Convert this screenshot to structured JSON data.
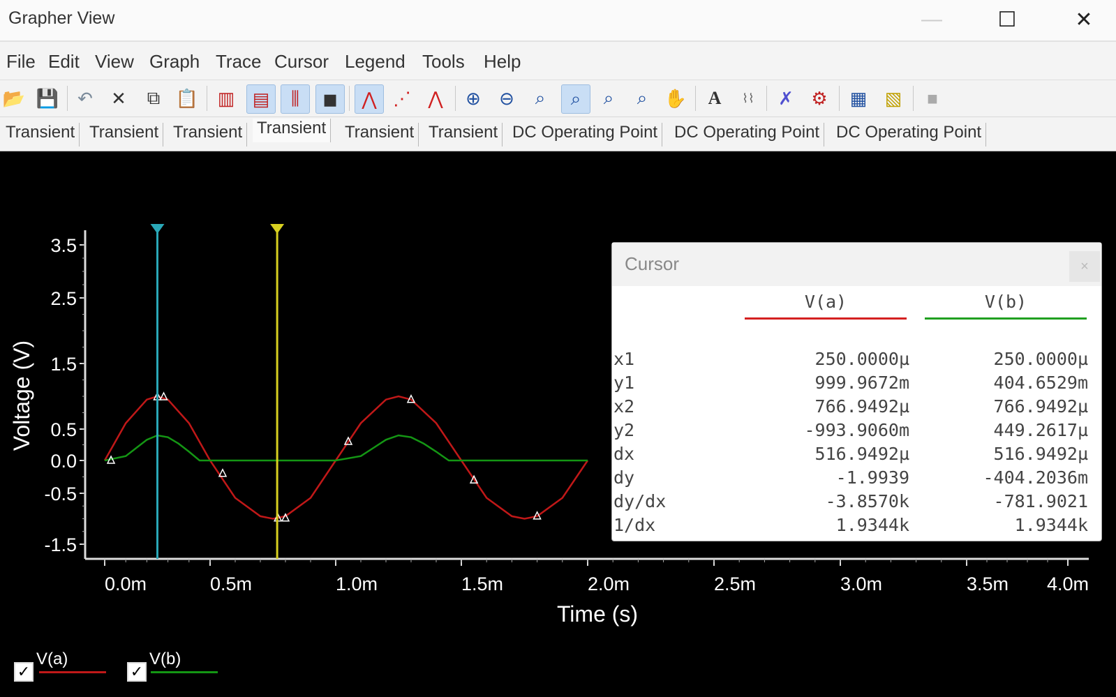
{
  "window": {
    "title": "Grapher View",
    "minimize_glyph": "—",
    "maximize_glyph": "☐",
    "close_glyph": "✕"
  },
  "menu": [
    "File",
    "Edit",
    "View",
    "Graph",
    "Trace",
    "Cursor",
    "Legend",
    "Tools",
    "Help"
  ],
  "toolbar_icons": [
    "open-icon",
    "save-icon",
    "undo-icon",
    "delete-icon",
    "copy-icon",
    "paste-icon",
    "grid-icon",
    "legend-toggle-icon",
    "cursors-icon",
    "background-toggle-icon",
    "line-trace-icon",
    "dots-trace-icon",
    "line-dots-trace-icon",
    "zoom-in-icon",
    "zoom-out-icon",
    "zoom-area-icon",
    "zoom-x-icon",
    "zoom-y-icon",
    "zoom-full-icon",
    "pan-hand-icon",
    "text-label-icon",
    "axis-label-icon",
    "trace-style-icon",
    "properties-icon",
    "export-icon",
    "overlay-icon",
    "stop-icon"
  ],
  "tabs": [
    {
      "label": "Transient",
      "selected": false
    },
    {
      "label": "Transient",
      "selected": false
    },
    {
      "label": "Transient",
      "selected": false
    },
    {
      "label": "Transient",
      "selected": true
    },
    {
      "label": "Transient",
      "selected": false
    },
    {
      "label": "Transient",
      "selected": false
    },
    {
      "label": "DC Operating Point",
      "selected": false
    },
    {
      "label": "DC Operating Point",
      "selected": false
    },
    {
      "label": "DC Operating Point",
      "selected": false
    }
  ],
  "cursor_panel": {
    "title": "Cursor",
    "close_glyph": "×",
    "columns": [
      {
        "name": "V(a)",
        "color": "#d42020"
      },
      {
        "name": "V(b)",
        "color": "#20a020"
      }
    ],
    "rows": [
      {
        "label": "x1",
        "va": "250.0000µ",
        "vb": "250.0000µ"
      },
      {
        "label": "y1",
        "va": "999.9672m",
        "vb": "404.6529m"
      },
      {
        "label": "x2",
        "va": "766.9492µ",
        "vb": "766.9492µ"
      },
      {
        "label": "y2",
        "va": "-993.9060m",
        "vb": "449.2617µ"
      },
      {
        "label": "dx",
        "va": "516.9492µ",
        "vb": "516.9492µ"
      },
      {
        "label": "dy",
        "va": "-1.9939",
        "vb": "-404.2036m"
      },
      {
        "label": "dy/dx",
        "va": "-3.8570k",
        "vb": "-781.9021"
      },
      {
        "label": "1/dx",
        "va": "1.9344k",
        "vb": "1.9344k"
      }
    ]
  },
  "legend": [
    {
      "name": "V(a)",
      "checked": true,
      "color": "#c01818"
    },
    {
      "name": "V(b)",
      "checked": true,
      "color": "#149614"
    }
  ],
  "chart_data": {
    "type": "line",
    "xlabel": "Time (s)",
    "ylabel": "Voltage (V)",
    "xlim": [
      0.0,
      4.0
    ],
    "ylim": [
      -1.5,
      3.5
    ],
    "x_unit": "ms",
    "x_ticks": [
      "0.0m",
      "0.5m",
      "1.0m",
      "1.5m",
      "2.0m",
      "2.5m",
      "3.0m",
      "3.5m",
      "4.0m"
    ],
    "y_ticks": [
      "3.5",
      "2.5",
      "1.5",
      "0.5",
      "0.0",
      "-0.5",
      "-1.5"
    ],
    "background": "#000000",
    "series": [
      {
        "name": "V(a)",
        "color": "#c01818",
        "x": [
          0.0,
          0.1,
          0.2,
          0.25,
          0.3,
          0.4,
          0.5,
          0.6,
          0.7,
          0.75,
          0.8,
          0.9,
          1.0,
          1.1,
          1.2,
          1.25,
          1.3,
          1.4,
          1.5,
          1.6,
          1.7,
          1.75,
          1.8,
          1.9,
          2.0
        ],
        "y": [
          0.0,
          0.59,
          0.95,
          1.0,
          0.95,
          0.59,
          0.0,
          -0.59,
          -0.95,
          -1.0,
          -0.95,
          -0.59,
          0.0,
          0.59,
          0.95,
          1.0,
          0.95,
          0.59,
          0.0,
          -0.59,
          -0.95,
          -1.0,
          -0.95,
          -0.59,
          0.0
        ]
      },
      {
        "name": "V(b)",
        "color": "#149614",
        "x": [
          0.0,
          0.1,
          0.15,
          0.2,
          0.25,
          0.3,
          0.35,
          0.4,
          0.45,
          0.5,
          1.0,
          1.1,
          1.15,
          1.2,
          1.25,
          1.3,
          1.35,
          1.4,
          1.45,
          1.5,
          2.0
        ],
        "y": [
          0.0,
          0.07,
          0.2,
          0.33,
          0.4,
          0.37,
          0.27,
          0.14,
          0.0,
          0.0,
          0.0,
          0.07,
          0.2,
          0.33,
          0.4,
          0.37,
          0.27,
          0.14,
          0.0,
          0.0,
          0.0
        ]
      }
    ],
    "cursors": [
      {
        "name": "cursor-1",
        "x": 0.25,
        "color": "#2aa8b8"
      },
      {
        "name": "cursor-2",
        "x": 0.767,
        "color": "#d8d020"
      }
    ],
    "markers": {
      "V(a)": [
        [
          0.03,
          0.0
        ],
        [
          0.28,
          0.99
        ],
        [
          0.8,
          -0.99
        ],
        [
          1.05,
          0.3
        ],
        [
          1.3,
          0.95
        ],
        [
          0.55,
          -0.2
        ],
        [
          1.55,
          -0.3
        ],
        [
          1.8,
          -0.95
        ]
      ],
      "V(b)": [
        [
          0.25,
          0.99
        ],
        [
          0.77,
          -0.99
        ]
      ]
    },
    "grid": false,
    "legend_position": "bottom-left"
  }
}
